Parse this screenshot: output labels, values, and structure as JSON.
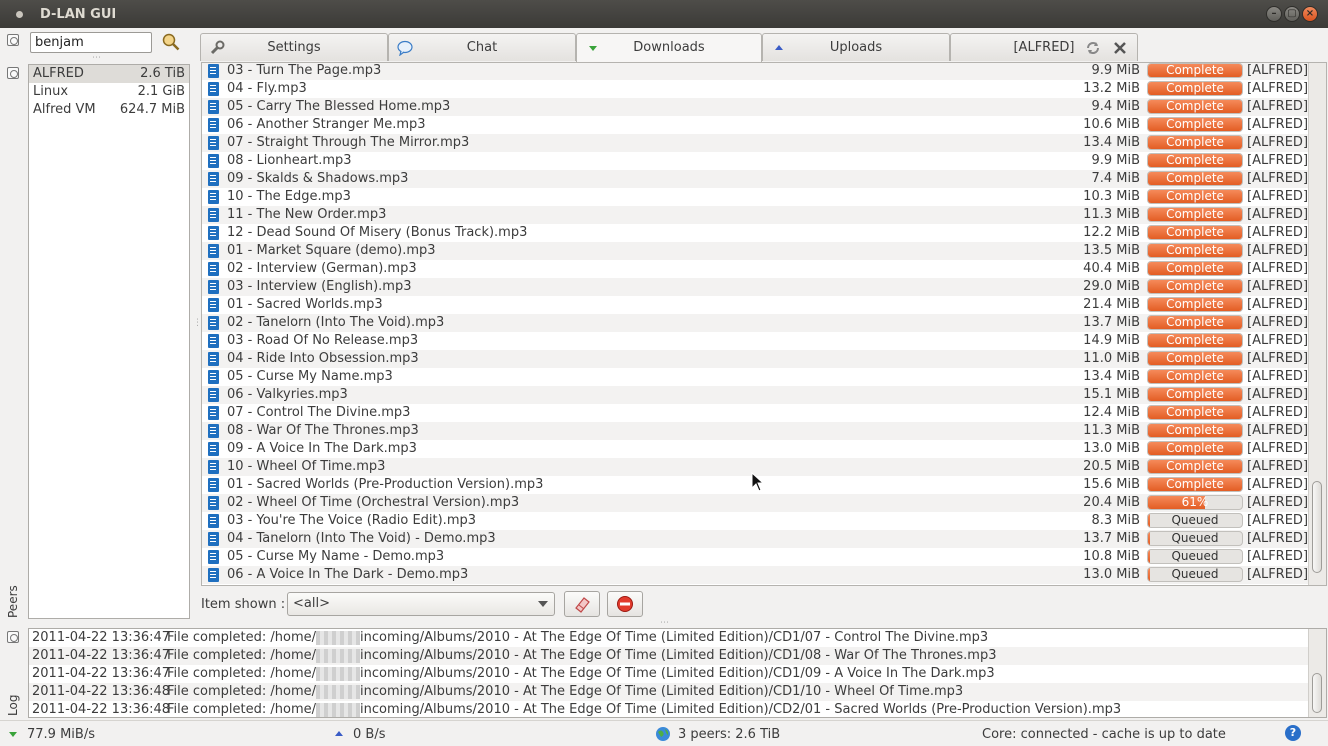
{
  "window": {
    "title": "D-LAN GUI",
    "minimize": "–",
    "maximize": "▢",
    "close": "×"
  },
  "sidebar": {
    "peers_label": "Peers",
    "log_label": "Log"
  },
  "search": {
    "value": "benjam"
  },
  "peers": [
    {
      "name": "ALFRED",
      "size": "2.6 TiB"
    },
    {
      "name": "Linux",
      "size": "2.1 GiB"
    },
    {
      "name": "Alfred VM",
      "size": "624.7 MiB"
    }
  ],
  "tabs": [
    {
      "label": "Settings",
      "icon": "wrench-icon"
    },
    {
      "label": "Chat",
      "icon": "speech-bubble-icon"
    },
    {
      "label": "Downloads",
      "icon": "down-arrow-icon"
    },
    {
      "label": "Uploads",
      "icon": "up-arrow-icon"
    },
    {
      "label": "[ALFRED]",
      "icon": "refresh-icon"
    }
  ],
  "downloads": [
    {
      "name": "03 - Turn The Page.mp3",
      "size": "9.9 MiB",
      "status": "Complete",
      "progress": 1,
      "peer": "[ALFRED]"
    },
    {
      "name": "04 - Fly.mp3",
      "size": "13.2 MiB",
      "status": "Complete",
      "progress": 1,
      "peer": "[ALFRED]"
    },
    {
      "name": "05 - Carry The Blessed Home.mp3",
      "size": "9.4 MiB",
      "status": "Complete",
      "progress": 1,
      "peer": "[ALFRED]"
    },
    {
      "name": "06 - Another Stranger Me.mp3",
      "size": "10.6 MiB",
      "status": "Complete",
      "progress": 1,
      "peer": "[ALFRED]"
    },
    {
      "name": "07 - Straight Through The Mirror.mp3",
      "size": "13.4 MiB",
      "status": "Complete",
      "progress": 1,
      "peer": "[ALFRED]"
    },
    {
      "name": "08 - Lionheart.mp3",
      "size": "9.9 MiB",
      "status": "Complete",
      "progress": 1,
      "peer": "[ALFRED]"
    },
    {
      "name": "09 - Skalds & Shadows.mp3",
      "size": "7.4 MiB",
      "status": "Complete",
      "progress": 1,
      "peer": "[ALFRED]"
    },
    {
      "name": "10 - The Edge.mp3",
      "size": "10.3 MiB",
      "status": "Complete",
      "progress": 1,
      "peer": "[ALFRED]"
    },
    {
      "name": "11 - The New Order.mp3",
      "size": "11.3 MiB",
      "status": "Complete",
      "progress": 1,
      "peer": "[ALFRED]"
    },
    {
      "name": "12 - Dead Sound Of Misery (Bonus Track).mp3",
      "size": "12.2 MiB",
      "status": "Complete",
      "progress": 1,
      "peer": "[ALFRED]"
    },
    {
      "name": "01 - Market Square (demo).mp3",
      "size": "13.5 MiB",
      "status": "Complete",
      "progress": 1,
      "peer": "[ALFRED]"
    },
    {
      "name": "02 - Interview (German).mp3",
      "size": "40.4 MiB",
      "status": "Complete",
      "progress": 1,
      "peer": "[ALFRED]"
    },
    {
      "name": "03 - Interview (English).mp3",
      "size": "29.0 MiB",
      "status": "Complete",
      "progress": 1,
      "peer": "[ALFRED]"
    },
    {
      "name": "01 - Sacred Worlds.mp3",
      "size": "21.4 MiB",
      "status": "Complete",
      "progress": 1,
      "peer": "[ALFRED]"
    },
    {
      "name": "02 - Tanelorn (Into The Void).mp3",
      "size": "13.7 MiB",
      "status": "Complete",
      "progress": 1,
      "peer": "[ALFRED]"
    },
    {
      "name": "03 - Road Of No Release.mp3",
      "size": "14.9 MiB",
      "status": "Complete",
      "progress": 1,
      "peer": "[ALFRED]"
    },
    {
      "name": "04 - Ride Into Obsession.mp3",
      "size": "11.0 MiB",
      "status": "Complete",
      "progress": 1,
      "peer": "[ALFRED]"
    },
    {
      "name": "05 - Curse My Name.mp3",
      "size": "13.4 MiB",
      "status": "Complete",
      "progress": 1,
      "peer": "[ALFRED]"
    },
    {
      "name": "06 - Valkyries.mp3",
      "size": "15.1 MiB",
      "status": "Complete",
      "progress": 1,
      "peer": "[ALFRED]"
    },
    {
      "name": "07 - Control The Divine.mp3",
      "size": "12.4 MiB",
      "status": "Complete",
      "progress": 1,
      "peer": "[ALFRED]"
    },
    {
      "name": "08 - War Of The Thrones.mp3",
      "size": "11.3 MiB",
      "status": "Complete",
      "progress": 1,
      "peer": "[ALFRED]"
    },
    {
      "name": "09 - A Voice In The Dark.mp3",
      "size": "13.0 MiB",
      "status": "Complete",
      "progress": 1,
      "peer": "[ALFRED]"
    },
    {
      "name": "10 - Wheel Of Time.mp3",
      "size": "20.5 MiB",
      "status": "Complete",
      "progress": 1,
      "peer": "[ALFRED]"
    },
    {
      "name": "01 - Sacred Worlds (Pre-Production Version).mp3",
      "size": "15.6 MiB",
      "status": "Complete",
      "progress": 1,
      "peer": "[ALFRED]"
    },
    {
      "name": "02 - Wheel Of Time (Orchestral Version).mp3",
      "size": "20.4 MiB",
      "status": "61%",
      "progress": 0.61,
      "peer": "[ALFRED]"
    },
    {
      "name": "03 - You're The Voice (Radio Edit).mp3",
      "size": "8.3 MiB",
      "status": "Queued",
      "progress": 0.02,
      "peer": "[ALFRED]"
    },
    {
      "name": "04 - Tanelorn (Into The Void) - Demo.mp3",
      "size": "13.7 MiB",
      "status": "Queued",
      "progress": 0.02,
      "peer": "[ALFRED]"
    },
    {
      "name": "05 - Curse My Name - Demo.mp3",
      "size": "10.8 MiB",
      "status": "Queued",
      "progress": 0.02,
      "peer": "[ALFRED]"
    },
    {
      "name": "06 - A Voice In The Dark - Demo.mp3",
      "size": "13.0 MiB",
      "status": "Queued",
      "progress": 0.02,
      "peer": "[ALFRED]"
    }
  ],
  "filter": {
    "label": "Item shown :",
    "selected": "<all>"
  },
  "buttons": {
    "clear_completed_icon": "eraser-icon",
    "remove_icon": "stop-icon"
  },
  "log": [
    {
      "time": "2011-04-22 13:36:47",
      "prefix": "File completed: /home/",
      "path": "incoming/Albums/2010 - At The Edge Of Time (Limited Edition)/CD1/07 - Control The Divine.mp3"
    },
    {
      "time": "2011-04-22 13:36:47",
      "prefix": "File completed: /home/",
      "path": "incoming/Albums/2010 - At The Edge Of Time (Limited Edition)/CD1/08 - War Of The Thrones.mp3"
    },
    {
      "time": "2011-04-22 13:36:47",
      "prefix": "File completed: /home/",
      "path": "incoming/Albums/2010 - At The Edge Of Time (Limited Edition)/CD1/09 - A Voice In The Dark.mp3"
    },
    {
      "time": "2011-04-22 13:36:48",
      "prefix": "File completed: /home/",
      "path": "incoming/Albums/2010 - At The Edge Of Time (Limited Edition)/CD1/10 - Wheel Of Time.mp3"
    },
    {
      "time": "2011-04-22 13:36:48",
      "prefix": "File completed: /home/",
      "path": "incoming/Albums/2010 - At The Edge Of Time (Limited Edition)/CD2/01 - Sacred Worlds (Pre-Production Version).mp3"
    }
  ],
  "status": {
    "download_rate": "77.9 MiB/s",
    "upload_rate": "0 B/s",
    "peers": "3 peers: 2.6 TiB",
    "core": "Core: connected - cache is up to date",
    "help": "?"
  },
  "colors": {
    "accent": "#e35d24",
    "file_icon": "#1f6fbf",
    "title_bar": "#3b3a37"
  }
}
